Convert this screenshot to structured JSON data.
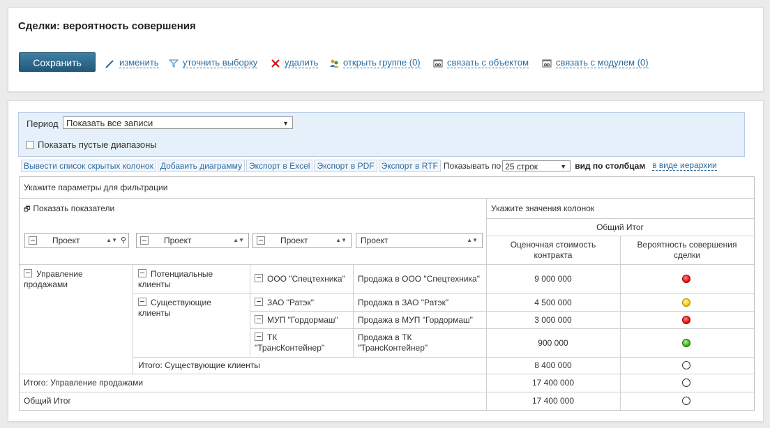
{
  "header": {
    "title": "Сделки: вероятность совершения",
    "save_label": "Сохранить",
    "toolbar": [
      {
        "label": "изменить",
        "icon": "pencil-icon"
      },
      {
        "label": "уточнить выборку",
        "icon": "filter-icon"
      },
      {
        "label": "удалить",
        "icon": "delete-icon"
      },
      {
        "label": "открыть группе (0)",
        "icon": "users-icon"
      },
      {
        "label": "связать с объектом",
        "icon": "link-object-icon"
      },
      {
        "label": "связать с модулем (0)",
        "icon": "link-module-icon"
      }
    ]
  },
  "filter": {
    "period_label": "Период",
    "period_value": "Показать все записи",
    "show_empty_label": "Показать пустые диапазоны"
  },
  "actions": {
    "hidden_columns": "Вывести список скрытых колонок",
    "add_chart": "Добавить диаграмму",
    "export_excel": "Экспорт в Excel",
    "export_pdf": "Экспорт в PDF",
    "export_rtf": "Экспорт в RTF",
    "rows_label": "Показывать по",
    "rows_value": "25 строк",
    "view_columns": "вид по столбцам",
    "view_hierarchy": "в виде иерархии"
  },
  "grid": {
    "filter_hint": "Укажите параметры для фильтрации",
    "show_indicators": "Показать показатели",
    "column_values_hint": "Укажите значения колонок",
    "grand_total_header": "Общий Итог",
    "dim_headers": [
      "Проект",
      "Проект",
      "Проект",
      "Проект"
    ],
    "col_cost": "Оценочная стоимость контракта",
    "col_prob": "Вероятность совершения сделки",
    "level1": "Управление продажами",
    "level2_potential": "Потенциальные клиенты",
    "level2_existing": "Существующие клиенты",
    "rows": [
      {
        "org": "ООО \"Спецтехника\"",
        "deal": "Продажа в ООО \"Спецтехника\"",
        "cost": "9 000 000",
        "status": "red"
      },
      {
        "org": "ЗАО \"Ратэк\"",
        "deal": "Продажа в ЗАО \"Ратэк\"",
        "cost": "4 500 000",
        "status": "yellow"
      },
      {
        "org": "МУП \"Гордормаш\"",
        "deal": "Продажа в МУП \"Гордормаш\"",
        "cost": "3 000 000",
        "status": "red"
      },
      {
        "org": "ТК \"ТрансКонтейнер\"",
        "deal": "Продажа в ТК \"ТрансКонтейнер\"",
        "cost": "900 000",
        "status": "green"
      }
    ],
    "totals": [
      {
        "label": "Итого: Существующие клиенты",
        "cost": "8 400 000",
        "status": "empty"
      },
      {
        "label": "Итого: Управление продажами",
        "cost": "17 400 000",
        "status": "empty"
      },
      {
        "label": "Общий Итог",
        "cost": "17 400 000",
        "status": "empty"
      }
    ]
  }
}
